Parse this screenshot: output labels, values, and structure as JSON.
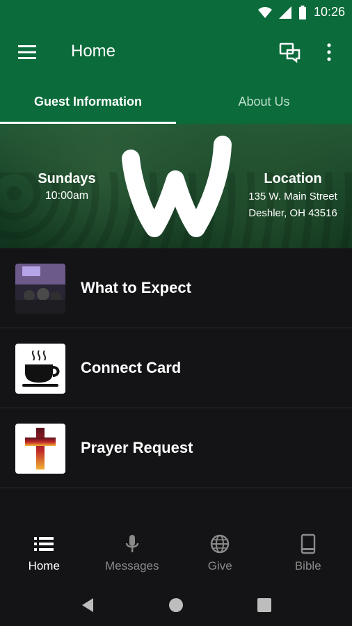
{
  "status": {
    "time": "10:26"
  },
  "appbar": {
    "title": "Home"
  },
  "tabs": [
    {
      "label": "Guest Information",
      "active": true
    },
    {
      "label": "About Us",
      "active": false
    }
  ],
  "hero": {
    "left": {
      "heading": "Sundays",
      "detail": "10:00am"
    },
    "right": {
      "heading": "Location",
      "line1": "135 W. Main Street",
      "line2": "Deshler, OH 43516"
    }
  },
  "list": [
    {
      "label": "What to Expect",
      "icon": "photo-thumbnail"
    },
    {
      "label": "Connect Card",
      "icon": "coffee-cup-icon"
    },
    {
      "label": "Prayer Request",
      "icon": "cross-icon"
    }
  ],
  "bottom_nav": [
    {
      "label": "Home",
      "icon": "list-icon",
      "active": true
    },
    {
      "label": "Messages",
      "icon": "microphone-icon",
      "active": false
    },
    {
      "label": "Give",
      "icon": "globe-icon",
      "active": false
    },
    {
      "label": "Bible",
      "icon": "book-icon",
      "active": false
    }
  ],
  "colors": {
    "primary": "#0b6b3a",
    "background": "#141416"
  }
}
